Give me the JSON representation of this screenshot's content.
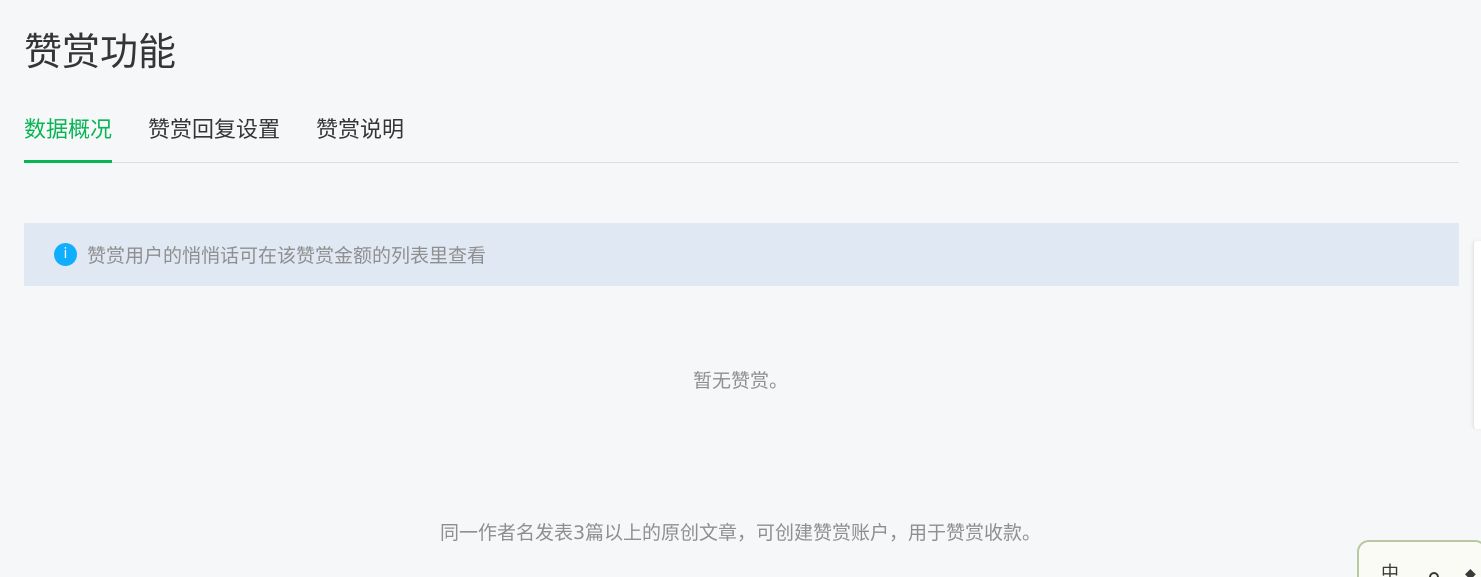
{
  "page": {
    "title": "赞赏功能"
  },
  "tabs": [
    {
      "label": "数据概况",
      "active": true
    },
    {
      "label": "赞赏回复设置",
      "active": false
    },
    {
      "label": "赞赏说明",
      "active": false
    }
  ],
  "notice": {
    "icon": "info-icon",
    "icon_glyph": "i",
    "text": "赞赏用户的悄悄话可在该赞赏金额的列表里查看"
  },
  "empty_state": {
    "text": "暂无赞赏。"
  },
  "footer": {
    "note": "同一作者名发表3篇以上的原创文章，可创建赞赏账户，用于赞赏收款。"
  },
  "ime_widget": {
    "char1": "中",
    "char3": "◆"
  },
  "colors": {
    "accent": "#07b553",
    "info": "#10aeff",
    "notice_bg": "#dfe8f3",
    "muted_text": "#8f8f8f"
  }
}
